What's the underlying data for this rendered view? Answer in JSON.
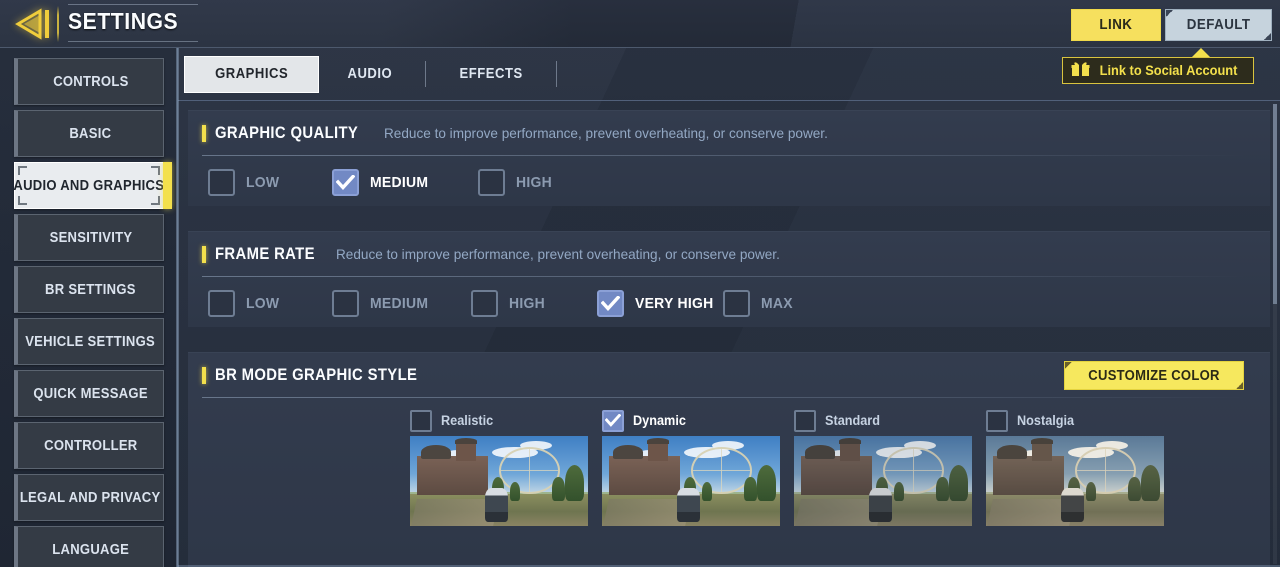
{
  "header": {
    "back_icon": "back-arrow-icon",
    "title": "SETTINGS",
    "link_button": "LINK",
    "default_button": "DEFAULT"
  },
  "sidebar": {
    "items": [
      {
        "label": "CONTROLS",
        "active": false
      },
      {
        "label": "BASIC",
        "active": false
      },
      {
        "label": "AUDIO AND GRAPHICS",
        "active": true
      },
      {
        "label": "SENSITIVITY",
        "active": false
      },
      {
        "label": "BR SETTINGS",
        "active": false
      },
      {
        "label": "VEHICLE SETTINGS",
        "active": false
      },
      {
        "label": "QUICK MESSAGE",
        "active": false
      },
      {
        "label": "CONTROLLER",
        "active": false
      },
      {
        "label": "LEGAL AND PRIVACY",
        "active": false
      },
      {
        "label": "LANGUAGE",
        "active": false
      }
    ]
  },
  "tabs": [
    {
      "label": "GRAPHICS",
      "active": true
    },
    {
      "label": "AUDIO",
      "active": false
    },
    {
      "label": "EFFECTS",
      "active": false
    }
  ],
  "link_social": {
    "label": "Link to Social Account",
    "icon": "gift-icon"
  },
  "sections": {
    "graphic_quality": {
      "title": "GRAPHIC QUALITY",
      "subtitle": "Reduce to improve performance, prevent overheating, or conserve power.",
      "options": [
        {
          "label": "LOW",
          "checked": false
        },
        {
          "label": "MEDIUM",
          "checked": true
        },
        {
          "label": "HIGH",
          "checked": false
        }
      ]
    },
    "frame_rate": {
      "title": "FRAME RATE",
      "subtitle": "Reduce to improve performance, prevent overheating, or conserve power.",
      "options": [
        {
          "label": "LOW",
          "checked": false
        },
        {
          "label": "MEDIUM",
          "checked": false
        },
        {
          "label": "HIGH",
          "checked": false
        },
        {
          "label": "VERY HIGH",
          "checked": true
        },
        {
          "label": "MAX",
          "checked": false
        }
      ]
    },
    "br_mode_graphic_style": {
      "title": "BR MODE GRAPHIC STYLE",
      "customize_button": "CUSTOMIZE COLOR",
      "styles": [
        {
          "label": "Realistic",
          "checked": false
        },
        {
          "label": "Dynamic",
          "checked": true
        },
        {
          "label": "Standard",
          "checked": false
        },
        {
          "label": "Nostalgia",
          "checked": false
        }
      ]
    }
  },
  "colors": {
    "accent_yellow": "#f3e04c",
    "checkbox_checked": "#7289c4",
    "active_tab_bg": "#e3e6e9",
    "panel_bg": "#2e3748",
    "default_button_bg": "#c6d3dd"
  }
}
